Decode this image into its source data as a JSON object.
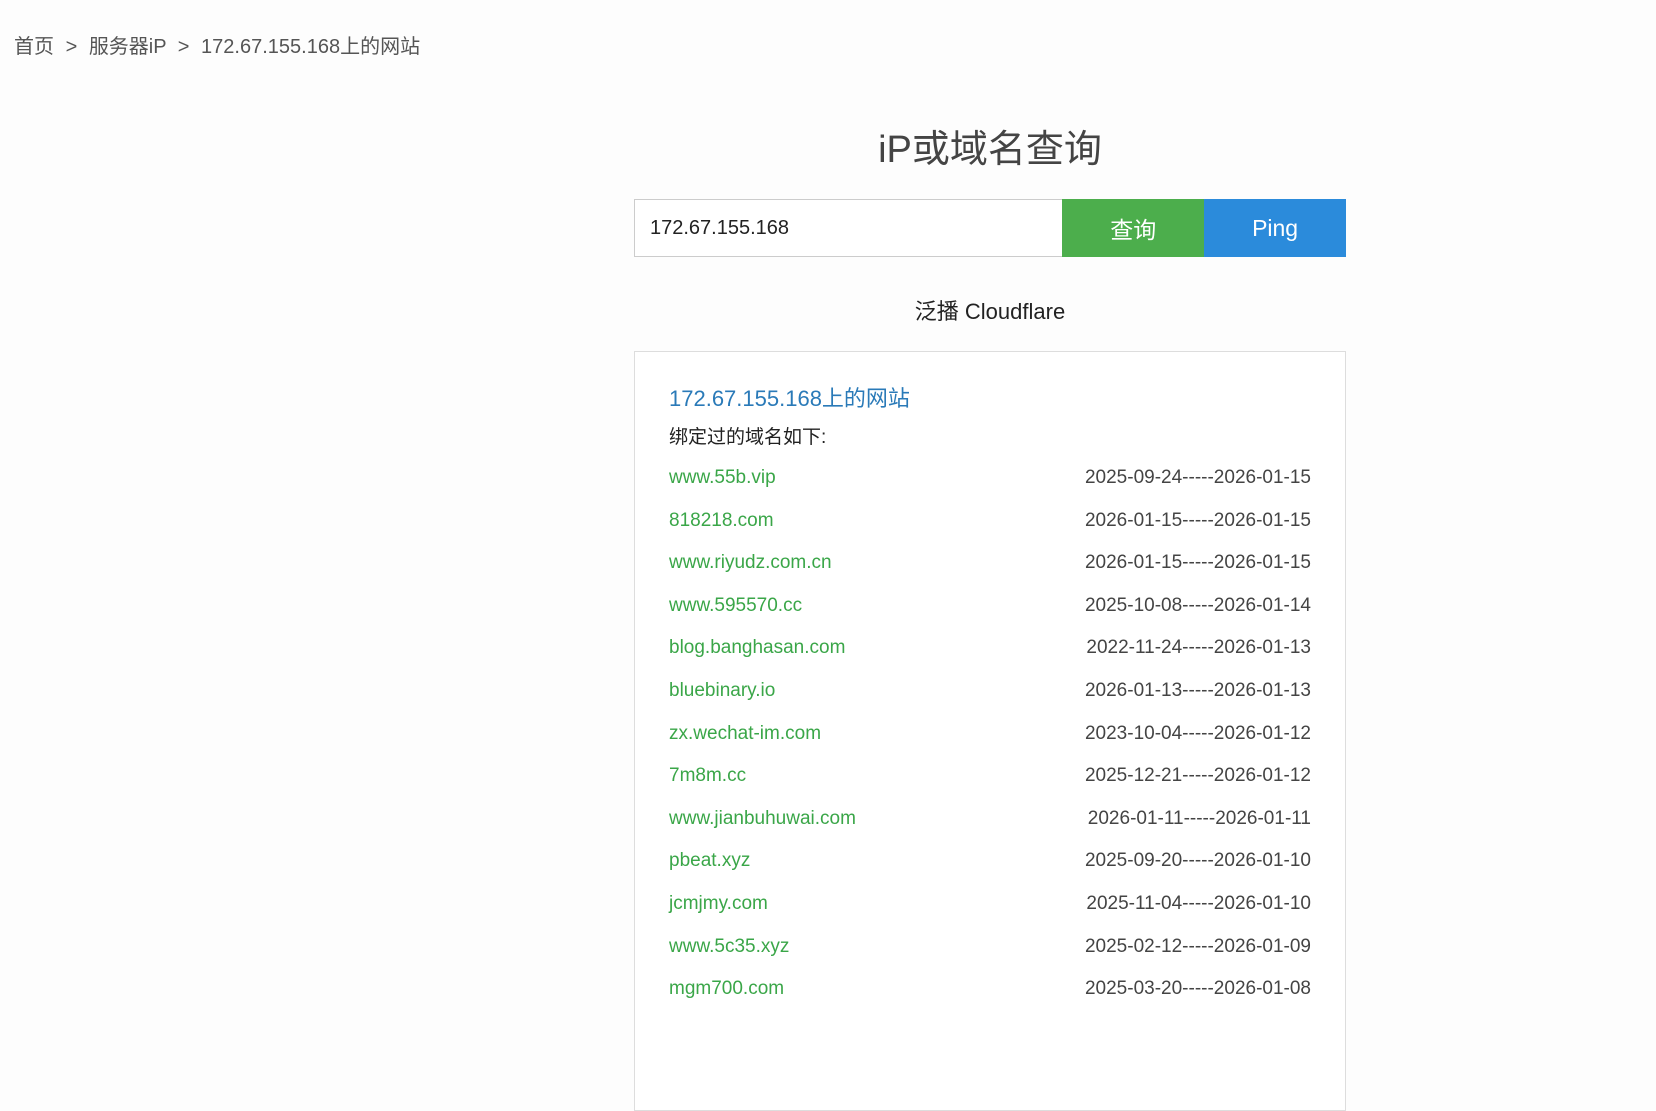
{
  "breadcrumb": {
    "home": "首页",
    "sep1": ">",
    "server_ip": "服务器iP",
    "sep2": ">",
    "current": "172.67.155.168上的网站"
  },
  "page_title": "iP或域名查询",
  "search": {
    "value": "172.67.155.168",
    "placeholder": "",
    "query_label": "查询",
    "ping_label": "Ping"
  },
  "ip_info": "泛播 Cloudflare",
  "panel": {
    "title": "172.67.155.168上的网站",
    "subtitle": "绑定过的域名如下:",
    "domains": [
      {
        "domain": "www.55b.vip",
        "dates": "2025-09-24-----2026-01-15"
      },
      {
        "domain": "818218.com",
        "dates": "2026-01-15-----2026-01-15"
      },
      {
        "domain": "www.riyudz.com.cn",
        "dates": "2026-01-15-----2026-01-15"
      },
      {
        "domain": "www.595570.cc",
        "dates": "2025-10-08-----2026-01-14"
      },
      {
        "domain": "blog.banghasan.com",
        "dates": "2022-11-24-----2026-01-13"
      },
      {
        "domain": "bluebinary.io",
        "dates": "2026-01-13-----2026-01-13"
      },
      {
        "domain": "zx.wechat-im.com",
        "dates": "2023-10-04-----2026-01-12"
      },
      {
        "domain": "7m8m.cc",
        "dates": "2025-12-21-----2026-01-12"
      },
      {
        "domain": "www.jianbuhuwai.com",
        "dates": "2026-01-11-----2026-01-11"
      },
      {
        "domain": "pbeat.xyz",
        "dates": "2025-09-20-----2026-01-10"
      },
      {
        "domain": "jcmjmy.com",
        "dates": "2025-11-04-----2026-01-10"
      },
      {
        "domain": "www.5c35.xyz",
        "dates": "2025-02-12-----2026-01-09"
      },
      {
        "domain": "mgm700.com",
        "dates": "2025-03-20-----2026-01-08"
      }
    ]
  }
}
